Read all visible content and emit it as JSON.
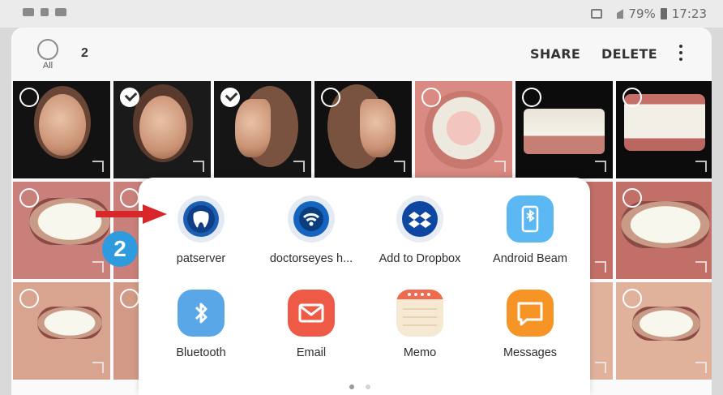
{
  "status_bar": {
    "battery": "79%",
    "time": "17:23"
  },
  "toolbar": {
    "all_label": "All",
    "selected_count": "2",
    "share_label": "SHARE",
    "delete_label": "DELETE",
    "more_icon": "more-vert-icon"
  },
  "gallery": {
    "selected_indices": [
      1,
      2
    ]
  },
  "share_sheet": {
    "apps": [
      {
        "label": "patserver",
        "icon": "tooth-icon",
        "color": "#1a5fb4"
      },
      {
        "label": "doctorseyes h...",
        "icon": "wifi-icon",
        "color": "#1565c0"
      },
      {
        "label": "Add to Dropbox",
        "icon": "dropbox-icon",
        "color": "#0d47a1"
      },
      {
        "label": "Android Beam",
        "icon": "android-beam-icon",
        "color": "#5cb8f2"
      },
      {
        "label": "Bluetooth",
        "icon": "bluetooth-icon",
        "color": "#5aa7e8"
      },
      {
        "label": "Email",
        "icon": "mail-icon",
        "color": "#ef5a46"
      },
      {
        "label": "Memo",
        "icon": "memo-icon",
        "color": "#f6e9d4"
      },
      {
        "label": "Messages",
        "icon": "message-icon",
        "color": "#f69426"
      }
    ]
  },
  "annotation": {
    "badge": "2"
  }
}
